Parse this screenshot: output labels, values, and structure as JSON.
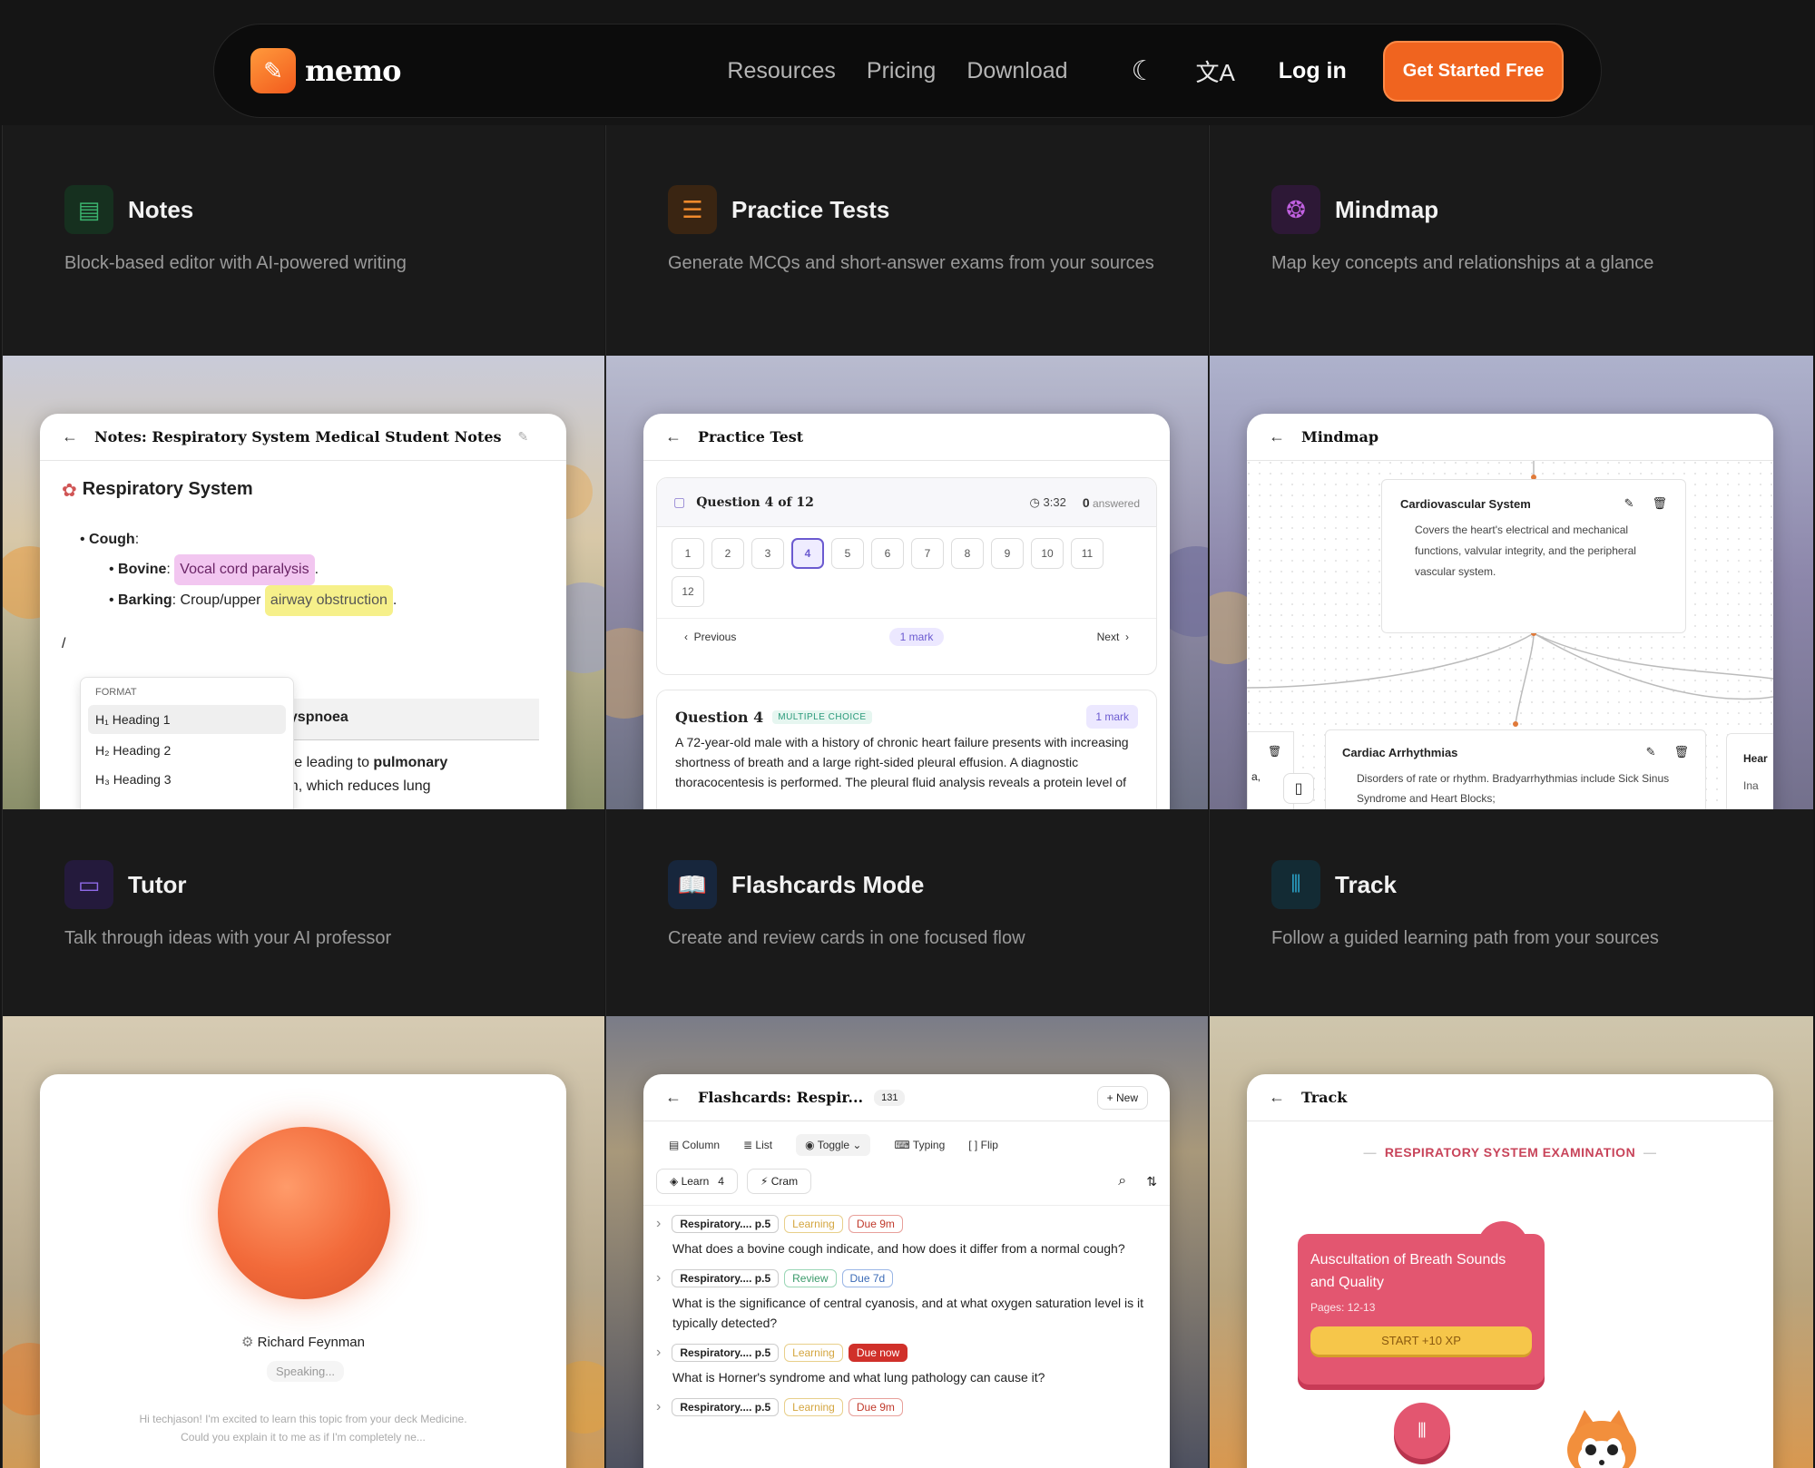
{
  "nav": {
    "logo": "memo",
    "links": [
      "Resources",
      "Pricing",
      "Download"
    ],
    "login": "Log in",
    "cta": "Get Started Free"
  },
  "features": [
    {
      "title": "Notes",
      "desc": "Block-based editor with AI-powered writing",
      "icon": "document-icon",
      "color": "#3bb36e"
    },
    {
      "title": "Practice Tests",
      "desc": "Generate MCQs and short-answer exams from your sources",
      "icon": "checklist-icon",
      "color": "#f08a2c"
    },
    {
      "title": "Mindmap",
      "desc": "Map key concepts and relationships at a glance",
      "icon": "brain-icon",
      "color": "#b25ad9"
    },
    {
      "title": "Tutor",
      "desc": "Talk through ideas with your AI professor",
      "icon": "chat-icon",
      "color": "#7a5ad9"
    },
    {
      "title": "Flashcards Mode",
      "desc": "Create and review cards in one focused flow",
      "icon": "book-icon",
      "color": "#3c83e6"
    },
    {
      "title": "Track",
      "desc": "Follow a guided learning path from your sources",
      "icon": "waveform-icon",
      "color": "#2ba3c9"
    }
  ],
  "notes": {
    "header": "Notes: Respiratory System Medical Student Notes",
    "heading": "Respiratory System",
    "cough": "Cough",
    "bovine": "Bovine",
    "bovine_val": "Vocal cord paralysis",
    "barking": "Barking",
    "barking_pre": ": Croup/upper",
    "barking_val": "airway obstruction",
    "slash": "/",
    "menu_label": "FORMAT",
    "menu": [
      "H₁ Heading 1",
      "H₂ Heading 2",
      "H₃ Heading 3"
    ],
    "behind1": "c Dyspnoea",
    "behind2": "ailure leading to",
    "behind2b": "pulmonary",
    "behind3": "ation, which reduces lung"
  },
  "practice": {
    "header": "Practice Test",
    "qcount": "Question 4 of 12",
    "time": "3:32",
    "answered_n": "0",
    "answered": "answered",
    "nums": [
      "1",
      "2",
      "3",
      "4",
      "5",
      "6",
      "7",
      "8",
      "9",
      "10",
      "11",
      "12"
    ],
    "prev": "Previous",
    "mark": "1 mark",
    "next": "Next",
    "qtitle": "Question 4",
    "qtype": "MULTIPLE CHOICE",
    "qmark": "1 mark",
    "qtext": "A 72-year-old male with a history of chronic heart failure presents with increasing shortness of breath and a large right-sided pleural effusion. A diagnostic thoracocentesis is performed. The pleural fluid analysis reveals a protein level of"
  },
  "mindmap": {
    "header": "Mindmap",
    "node1_title": "Cardiovascular System",
    "node1_text": "Covers the heart's electrical and mechanical functions, valvular integrity, and the peripheral vascular system.",
    "node2_title": "Cardiac Arrhythmias",
    "node2_text": "Disorders of rate or rhythm. Bradyarrhythmias include Sick Sinus Syndrome and Heart Blocks;",
    "node3_title": "Hear",
    "node3_text": "Ina",
    "left_frag": "a,"
  },
  "tutor": {
    "name": "Richard Feynman",
    "status": "Speaking...",
    "transcript": "Hi techjason! I'm excited to learn this topic from your deck Medicine. Could you explain it to me as if I'm completely ne..."
  },
  "flash": {
    "header": "Flashcards: Respir...",
    "count": "131",
    "new": "+ New",
    "views": [
      "Column",
      "List",
      "Toggle",
      "Typing",
      "Flip"
    ],
    "learn": "Learn",
    "learn_n": "4",
    "cram": "Cram",
    "cards": [
      {
        "src": "Respiratory.... p.5",
        "status": "Learning",
        "due": "Due 9m",
        "q": "What does a bovine cough indicate, and how does it differ from a normal cough?"
      },
      {
        "src": "Respiratory.... p.5",
        "status": "Review",
        "due": "Due 7d",
        "q": "What is the significance of central cyanosis, and at what oxygen saturation level is it typically detected?"
      },
      {
        "src": "Respiratory.... p.5",
        "status": "Learning",
        "due": "Due now",
        "q": "What is Horner's syndrome and what lung pathology can cause it?"
      },
      {
        "src": "Respiratory.... p.5",
        "status": "Learning",
        "due": "Due 9m",
        "q": ""
      }
    ]
  },
  "track": {
    "header": "Track",
    "section": "RESPIRATORY SYSTEM EXAMINATION",
    "card_title": "Auscultation of Breath Sounds and Quality",
    "pages": "Pages: 12-13",
    "start": "START +10 XP"
  }
}
